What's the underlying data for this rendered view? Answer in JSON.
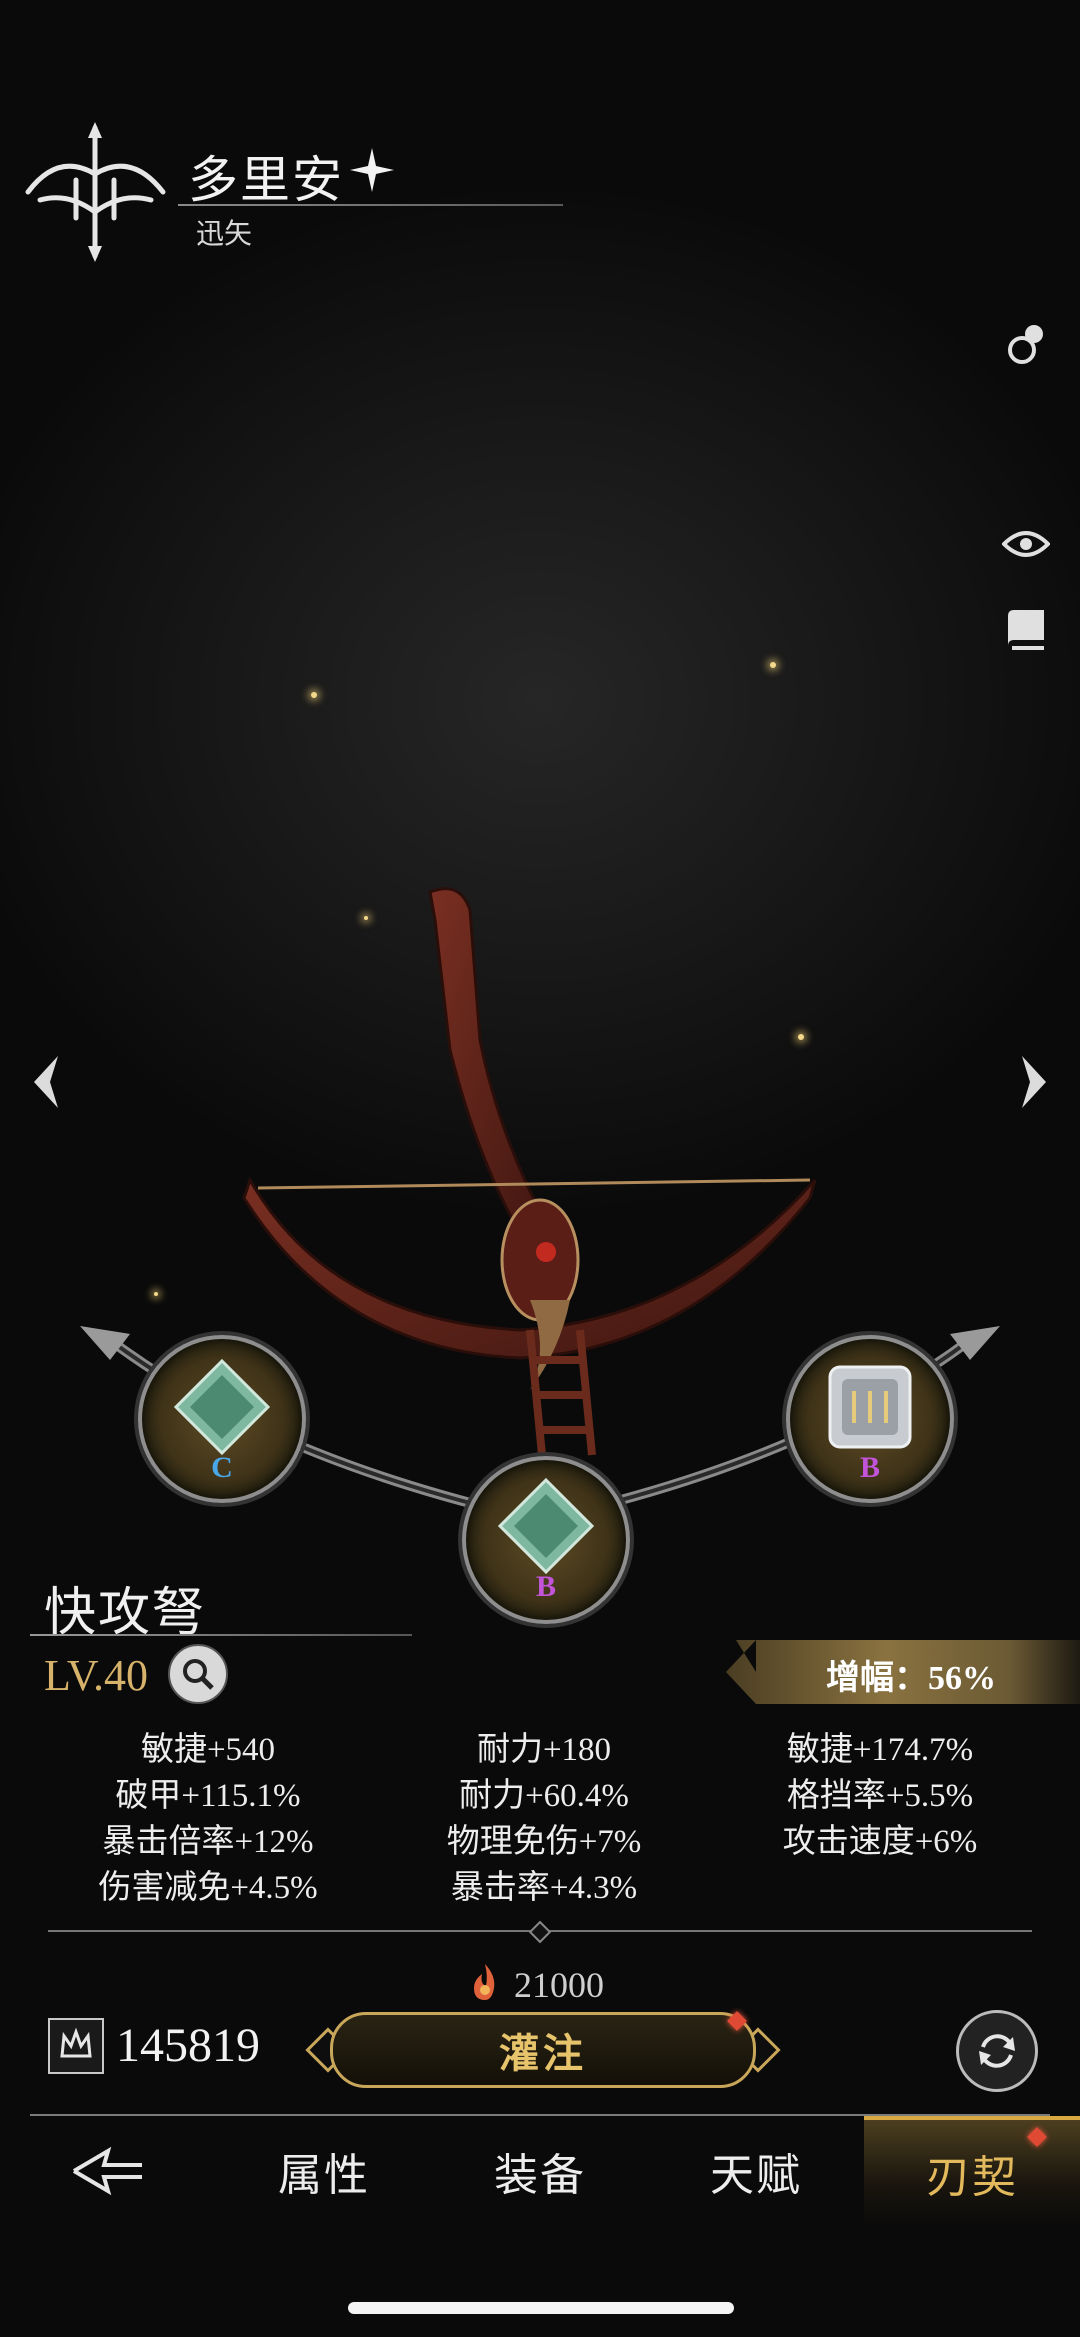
{
  "header": {
    "hero_name": "多里安",
    "hero_title": "迅矢"
  },
  "weapon": {
    "name": "快攻弩",
    "level": "LV.40",
    "amplify": "增幅：56%"
  },
  "gems": [
    {
      "grade": "C",
      "grade_color": "#4aa8e8"
    },
    {
      "grade": "B",
      "grade_color": "#c154d8"
    },
    {
      "grade": "B",
      "grade_color": "#c154d8"
    }
  ],
  "stats": [
    "敏捷+540",
    "耐力+180",
    "敏捷+174.7%",
    "破甲+115.1%",
    "耐力+60.4%",
    "格挡率+5.5%",
    "暴击倍率+12%",
    "物理免伤+7%",
    "攻击速度+6%",
    "伤害减免+4.5%",
    "暴击率+4.3%",
    ""
  ],
  "footer": {
    "cost": "21000",
    "power": "145819",
    "infuse_label": "灌注"
  },
  "nav": {
    "items": [
      "属性",
      "装备",
      "天赋",
      "刃契"
    ],
    "active": "刃契"
  },
  "colors": {
    "gold": "#d6b26a",
    "accent_red": "#e04a34"
  }
}
